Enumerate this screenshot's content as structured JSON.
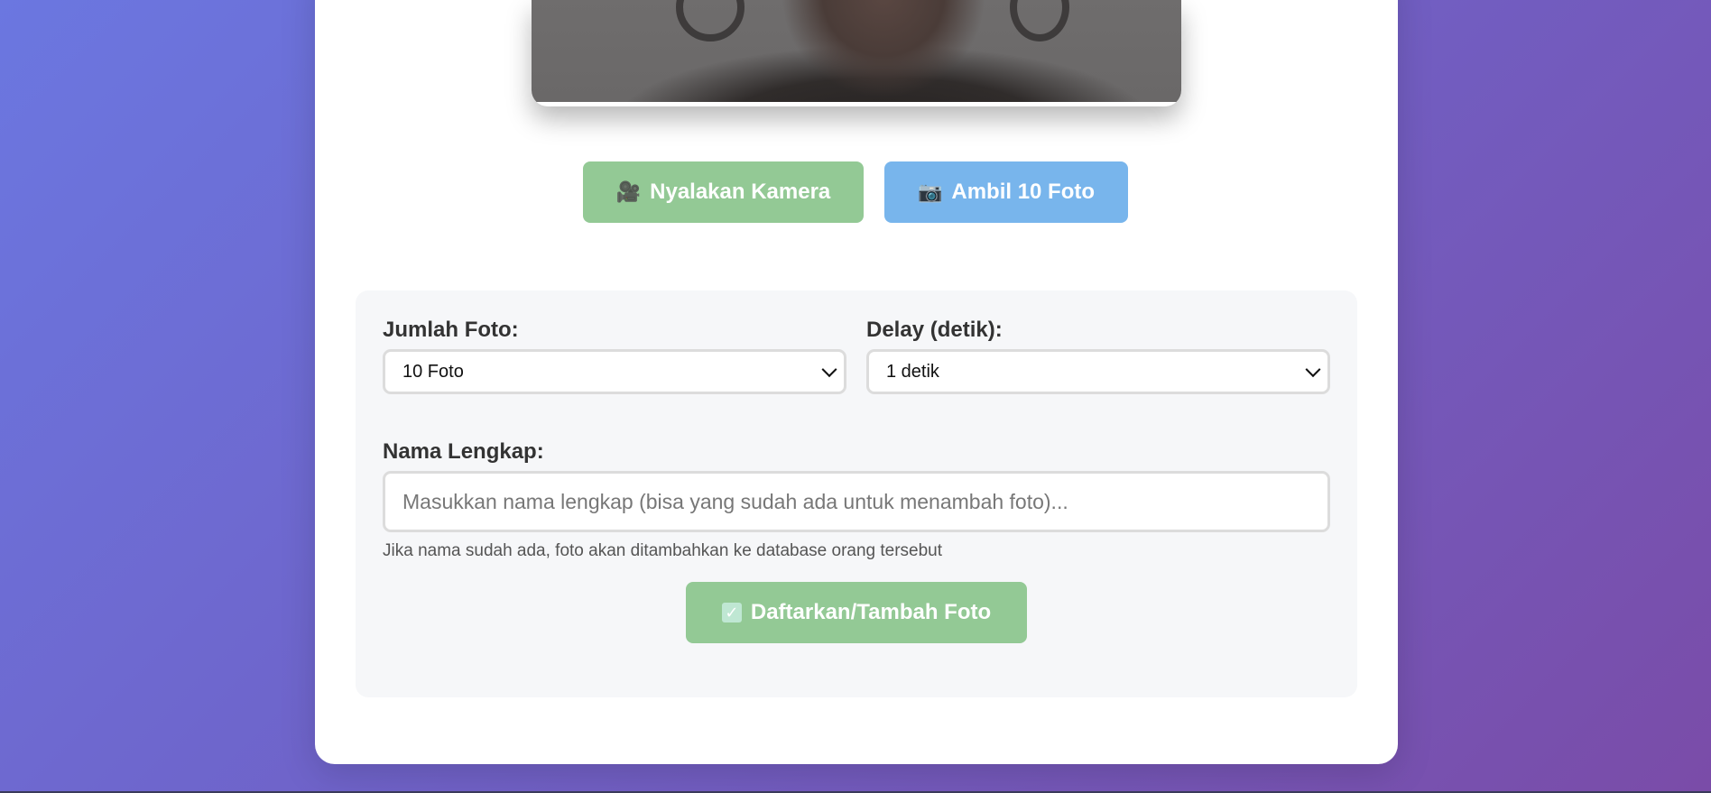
{
  "camera": {
    "start_label": "Nyalakan Kamera",
    "start_icon": "video-camera-icon",
    "capture_label": "Ambil 10 Foto",
    "capture_icon": "camera-icon"
  },
  "settings": {
    "photo_count_label": "Jumlah Foto:",
    "photo_count_value": "10 Foto",
    "delay_label": "Delay (detik):",
    "delay_value": "1 detik"
  },
  "form": {
    "name_label": "Nama Lengkap:",
    "name_placeholder": "Masukkan nama lengkap (bisa yang sudah ada untuk menambah foto)...",
    "name_value": "",
    "hint": "Jika nama sudah ada, foto akan ditambahkan ke database orang tersebut",
    "submit_label": "Daftarkan/Tambah Foto",
    "submit_icon": "check-box-icon"
  },
  "colors": {
    "background_start": "#6b77e0",
    "background_end": "#7a4ca8",
    "green_button": "#93c995",
    "blue_button": "#78b5ec",
    "panel": "#f6f7f9"
  }
}
